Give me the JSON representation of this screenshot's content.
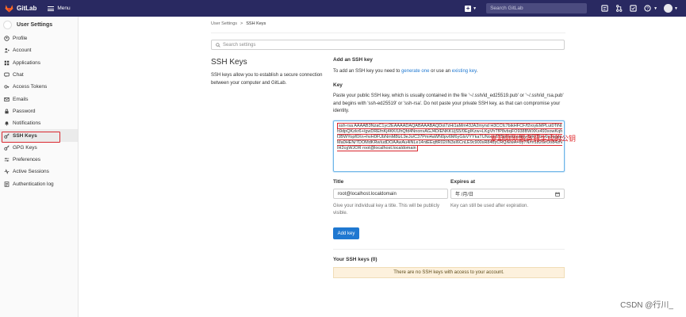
{
  "topbar": {
    "brand": "GitLab",
    "menu_label": "Menu",
    "search_placeholder": "Search GitLab",
    "plus": "+"
  },
  "sidebar": {
    "title": "User Settings",
    "items": [
      {
        "label": "Profile",
        "icon": "profile-icon"
      },
      {
        "label": "Account",
        "icon": "account-icon"
      },
      {
        "label": "Applications",
        "icon": "applications-icon"
      },
      {
        "label": "Chat",
        "icon": "chat-icon"
      },
      {
        "label": "Access Tokens",
        "icon": "token-icon"
      },
      {
        "label": "Emails",
        "icon": "email-icon"
      },
      {
        "label": "Password",
        "icon": "lock-icon"
      },
      {
        "label": "Notifications",
        "icon": "bell-icon"
      },
      {
        "label": "SSH Keys",
        "icon": "key-icon"
      },
      {
        "label": "GPG Keys",
        "icon": "key-icon"
      },
      {
        "label": "Preferences",
        "icon": "sliders-icon"
      },
      {
        "label": "Active Sessions",
        "icon": "sessions-icon"
      },
      {
        "label": "Authentication log",
        "icon": "log-icon"
      }
    ]
  },
  "breadcrumb": {
    "parent": "User Settings",
    "sep": ">",
    "current": "SSH Keys"
  },
  "settings_search_placeholder": "Search settings",
  "left": {
    "heading": "SSH Keys",
    "description": "SSH keys allow you to establish a secure connection between your computer and GitLab."
  },
  "right": {
    "heading": "Add an SSH key",
    "to_add_prefix": "To add an SSH key you need to ",
    "generate_link": "generate one",
    "or_text": " or use an ",
    "existing_link": "existing key",
    "period": ".",
    "key_label": "Key",
    "paste_desc": "Paste your public SSH key, which is usually contained in the file '~/.ssh/id_ed25519.pub' or '~/.ssh/id_rsa.pub' and begins with 'ssh-ed25519' or 'ssh-rsa'. Do not paste your private SSH key, as that can compromise your identity.",
    "key_value": "ssh-rsa AAAAB3NzaC1yc2EAAAADAQABAAABAQDol7zHi1aMm43JA2mynd H3CCfc7bikHFCF/f2royEMPLut0TiNth9dpQKzkr6+/gwDREfnKj4KK/UhQfd4NnonvAGJ4D/ENKKUjS5/0EgIKzw+LKgVhTfP8vbqFO938BWXKx493xowKqhfJBWYopf0Xn+hvH0FUbNmM8tzL9eJo/C37Pmi4aWN0pv6M6yGlsVYYkaTUNoobTY5pNekceAiky/SjR/Tibc/0x3qgppMa0HEN/7DOMdKRwIudDOAAwAu4iNLe14ntEEqftR02/iN3sI6CnLE9c900sR848yCRQ/EwA+8y7N/m182GrOo84zNIH2cgWJOR root@localhost.localdomain",
    "annotation": "复制刚刚服务器生成的公钥",
    "title_label": "Title",
    "title_value": "root@localhost.localdomain",
    "title_hint": "Give your individual key a title. This will be publicly visible.",
    "expires_label": "Expires at",
    "expires_value": "年 /月/日",
    "expires_hint": "Key can still be used after expiration.",
    "add_button": "Add key",
    "your_keys": "Your SSH keys (0)",
    "no_keys": "There are no SSH keys with access to your account."
  },
  "watermark": "CSDN @行川_",
  "colors": {
    "navbar": "#292961",
    "accent": "#1f78d1",
    "annotation": "#e0262a",
    "warning_bg": "#fdf1dd"
  }
}
